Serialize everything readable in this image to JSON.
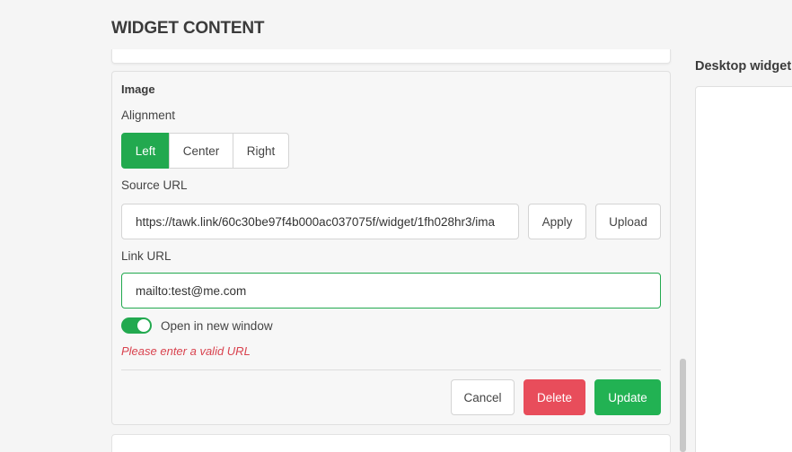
{
  "page": {
    "title": "WIDGET CONTENT"
  },
  "image_section": {
    "title": "Image",
    "alignment": {
      "label": "Alignment",
      "options": [
        "Left",
        "Center",
        "Right"
      ],
      "selected": "Left"
    },
    "source_url": {
      "label": "Source URL",
      "value": "https://tawk.link/60c30be97f4b000ac037075f/widget/1fh028hr3/ima",
      "apply_label": "Apply",
      "upload_label": "Upload"
    },
    "link_url": {
      "label": "Link URL",
      "value": "mailto:test@me.com"
    },
    "open_new_window": {
      "label": "Open in new window",
      "checked": true
    },
    "error": "Please enter a valid URL",
    "actions": {
      "cancel": "Cancel",
      "delete": "Delete",
      "update": "Update"
    }
  },
  "preview": {
    "title": "Desktop widget"
  },
  "colors": {
    "accent": "#22a94f",
    "danger": "#e84d5b",
    "error_text": "#d9434f"
  }
}
